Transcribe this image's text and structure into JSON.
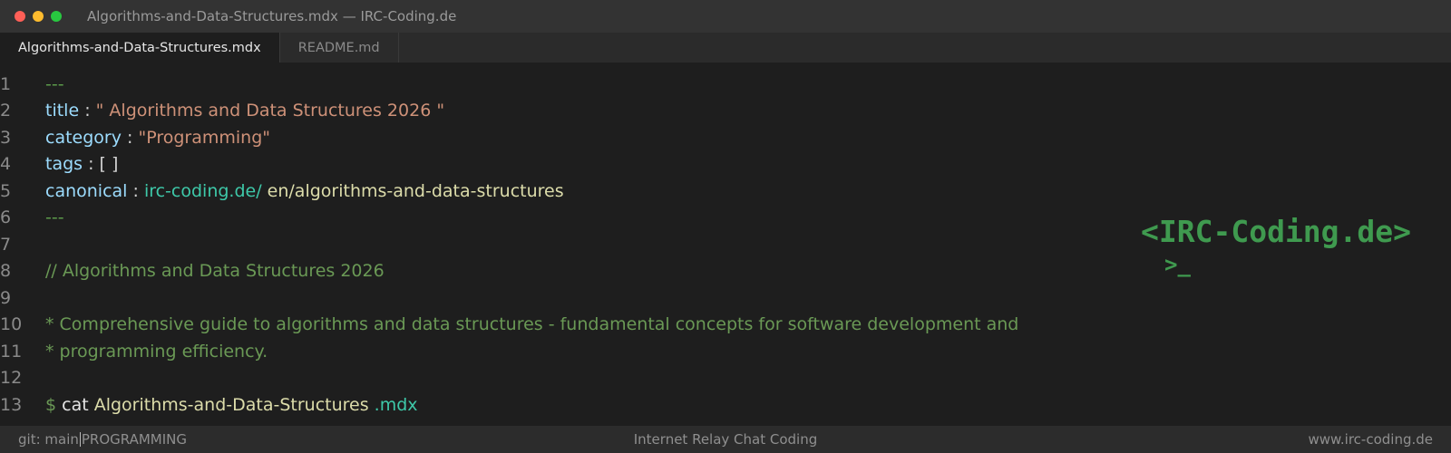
{
  "window": {
    "title": "Algorithms-and-Data-Structures.mdx — IRC-Coding.de",
    "buttons": {
      "close_color": "#ff5f57",
      "minimize_color": "#febc2e",
      "maximize_color": "#28c840"
    }
  },
  "tabs": [
    {
      "label": "Algorithms-and-Data-Structures.mdx",
      "active": true
    },
    {
      "label": "README.md",
      "active": false
    }
  ],
  "editor": {
    "line_numbers": [
      "1",
      "2",
      "3",
      "4",
      "5",
      "6",
      "7",
      "8",
      "9",
      "10",
      "11",
      "12",
      "13"
    ],
    "lines": {
      "l1": {
        "dashes": "---"
      },
      "l2": {
        "key": "title",
        "sep": " : ",
        "value": "\" Algorithms and Data Structures 2026 \""
      },
      "l3": {
        "key": "category",
        "sep": " : ",
        "value": "\"Programming\""
      },
      "l4": {
        "key": "tags",
        "sep": " : ",
        "value": "[ ]"
      },
      "l5": {
        "key": "canonical",
        "sep": " : ",
        "domain": "irc-coding.de/",
        "path": " en/algorithms-and-data-structures"
      },
      "l6": {
        "dashes": "---"
      },
      "l8": {
        "comment": "// Algorithms and Data Structures 2026"
      },
      "l10": {
        "comment": "* Comprehensive guide to algorithms and data structures - fundamental concepts for software development and"
      },
      "l11": {
        "comment": "* programming efficiency."
      },
      "l13": {
        "prompt": "$",
        "cmd": " cat ",
        "file": "Algorithms-and-Data-Structures",
        "ext": " .mdx"
      }
    }
  },
  "logo": {
    "text": "<IRC-Coding.de>",
    "prompt": ">_"
  },
  "statusbar": {
    "branch": "git: main",
    "category": "PROGRAMMING",
    "center": "Internet Relay Chat Coding",
    "right": "www.irc-coding.de"
  }
}
